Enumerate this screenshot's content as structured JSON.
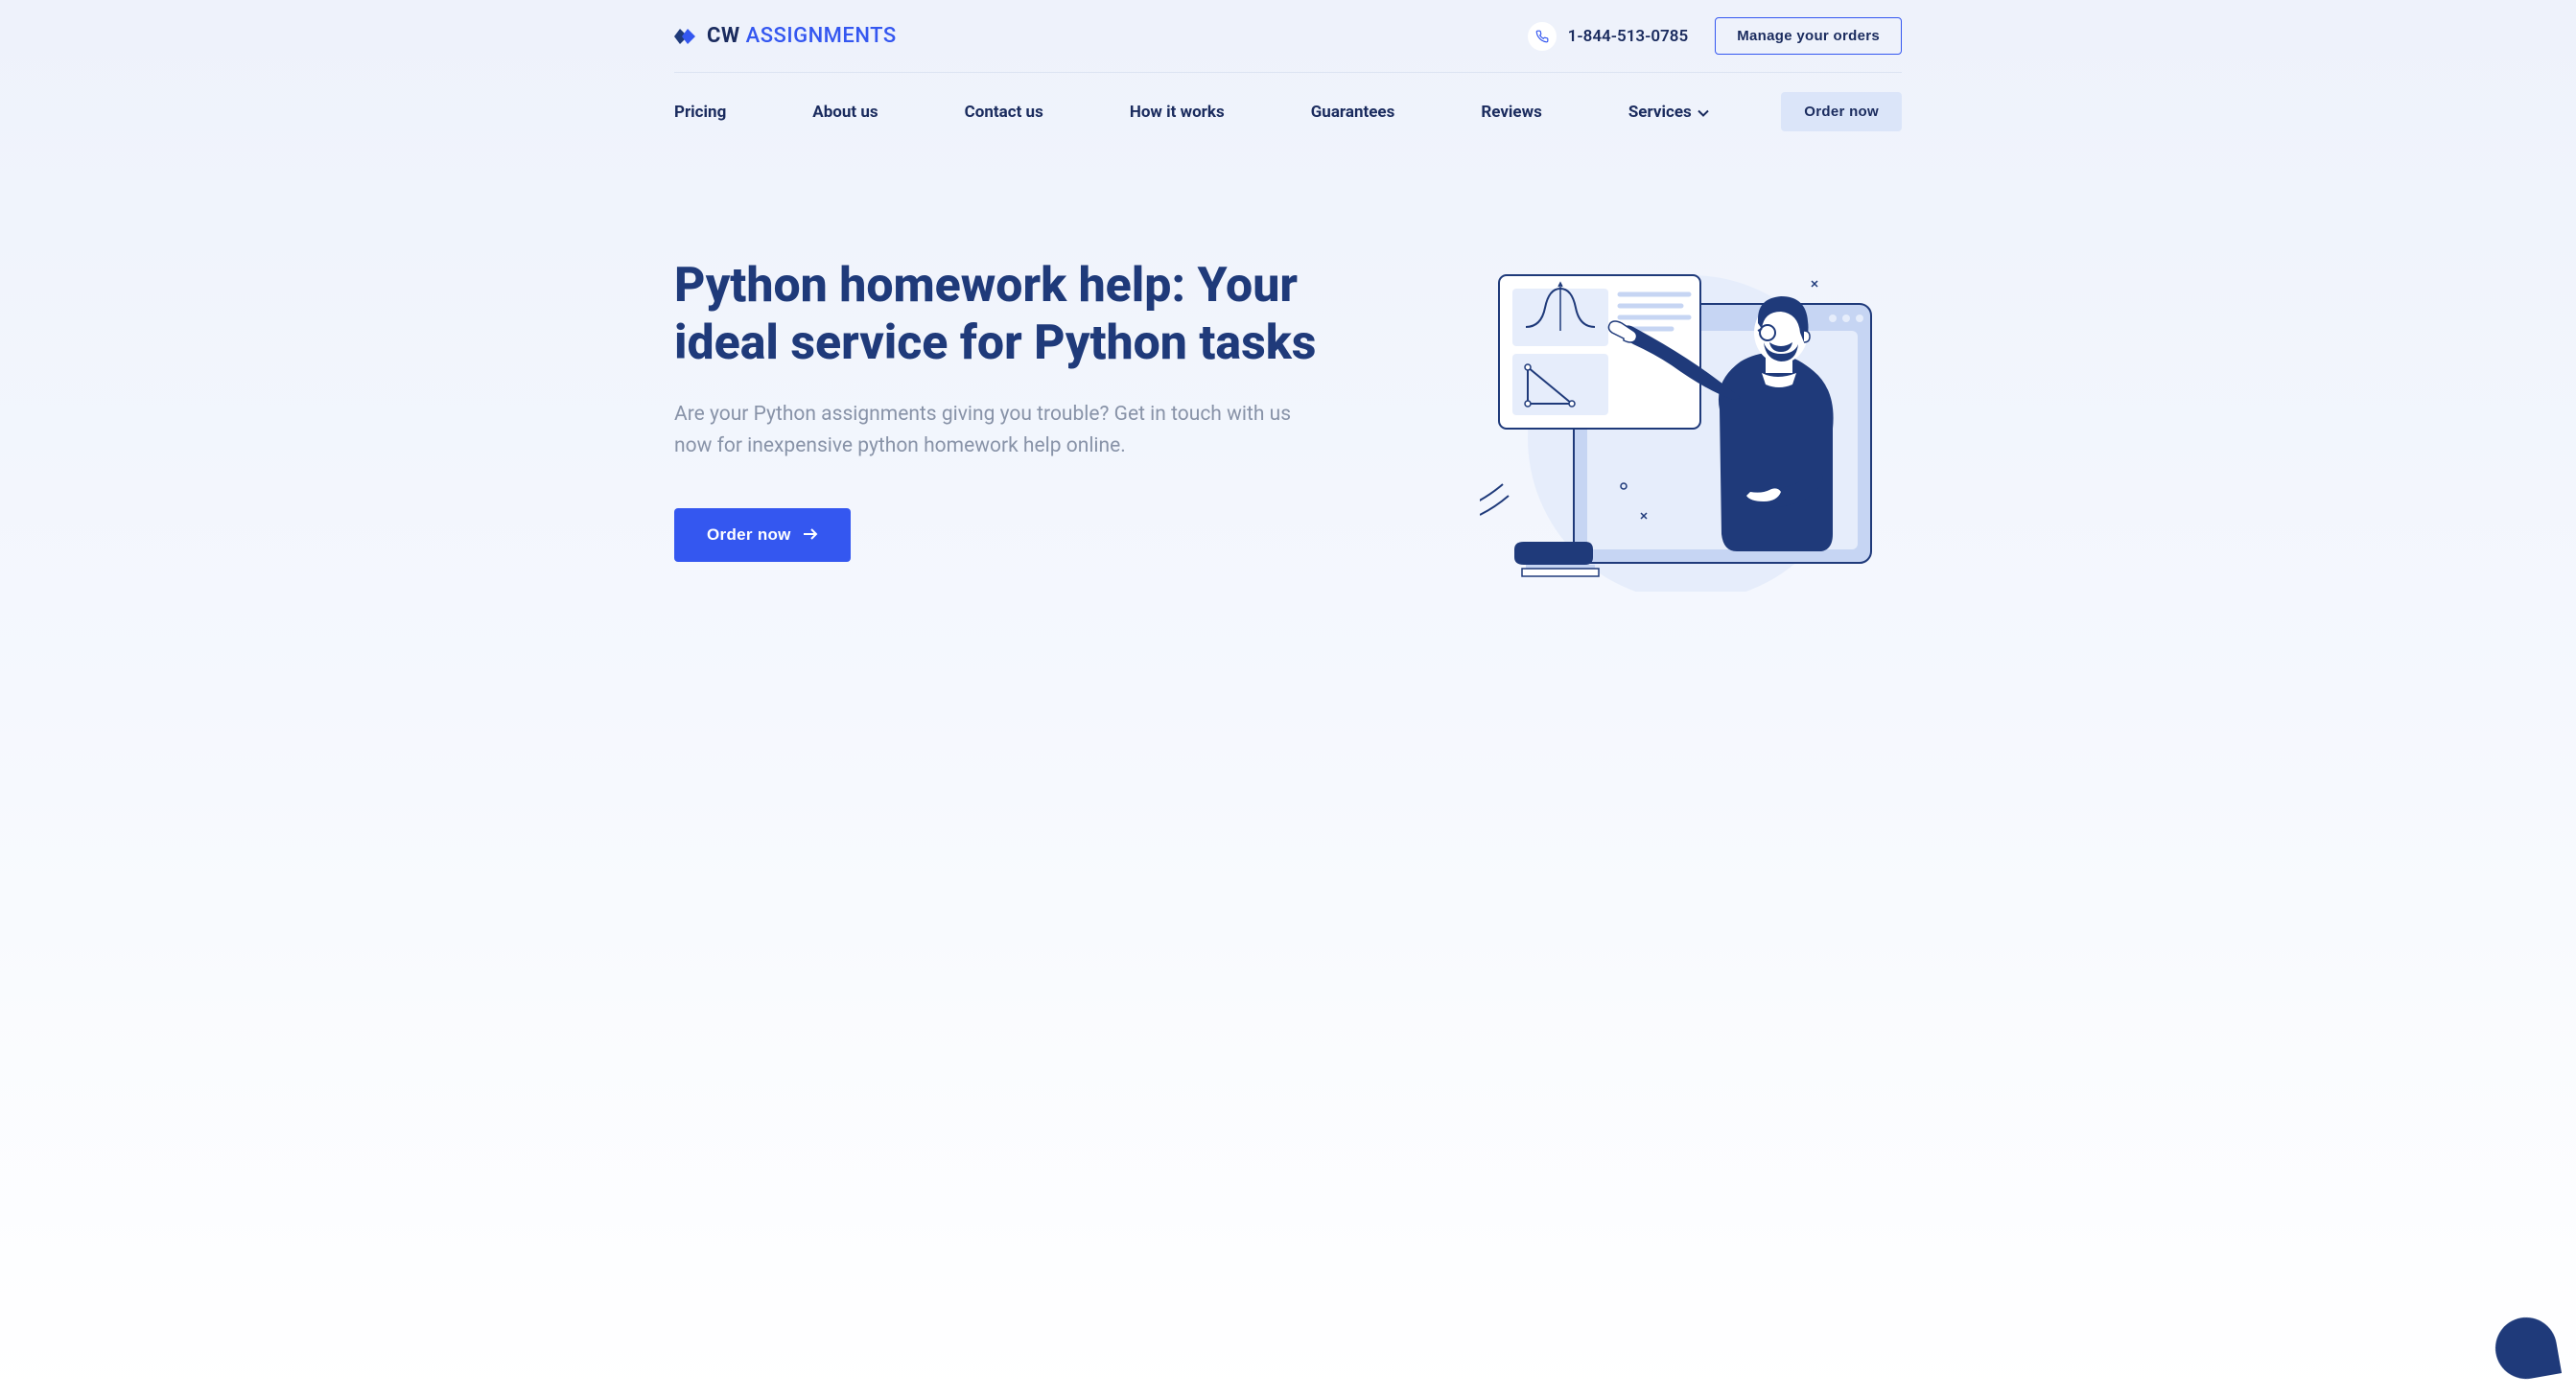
{
  "header": {
    "logo_cw": "CW",
    "logo_assignments": "ASSIGNMENTS",
    "phone": "1-844-513-0785",
    "manage_orders": "Manage your orders"
  },
  "nav": {
    "items": [
      {
        "label": "Pricing"
      },
      {
        "label": "About us"
      },
      {
        "label": "Contact us"
      },
      {
        "label": "How it works"
      },
      {
        "label": "Guarantees"
      },
      {
        "label": "Reviews"
      },
      {
        "label": "Services"
      }
    ],
    "order_now": "Order now"
  },
  "hero": {
    "title": "Python homework help: Your ideal service for Python tasks",
    "subtitle": "Are your Python assignments giving you trouble? Get in touch with us now for inexpensive python homework help online.",
    "cta": "Order now"
  }
}
